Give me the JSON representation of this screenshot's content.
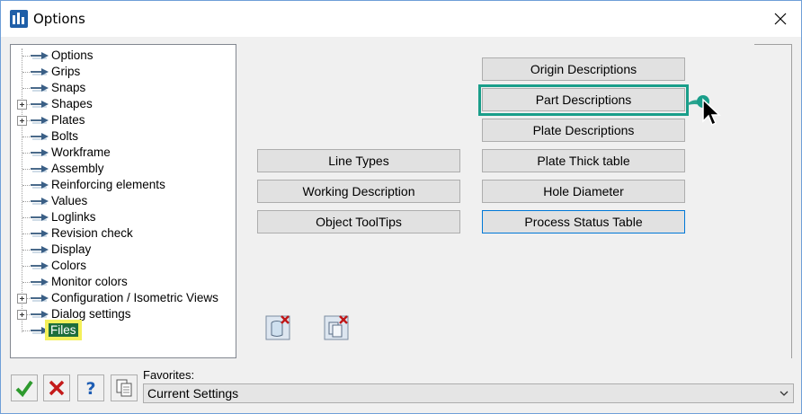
{
  "window": {
    "title": "Options"
  },
  "tree": {
    "items": [
      {
        "label": "Options",
        "expandable": false
      },
      {
        "label": "Grips",
        "expandable": false
      },
      {
        "label": "Snaps",
        "expandable": false
      },
      {
        "label": "Shapes",
        "expandable": true
      },
      {
        "label": "Plates",
        "expandable": true
      },
      {
        "label": "Bolts",
        "expandable": false
      },
      {
        "label": "Workframe",
        "expandable": false
      },
      {
        "label": "Assembly",
        "expandable": false
      },
      {
        "label": "Reinforcing elements",
        "expandable": false
      },
      {
        "label": "Values",
        "expandable": false
      },
      {
        "label": "Loglinks",
        "expandable": false
      },
      {
        "label": "Revision check",
        "expandable": false
      },
      {
        "label": "Display",
        "expandable": false
      },
      {
        "label": "Colors",
        "expandable": false
      },
      {
        "label": "Monitor colors",
        "expandable": false
      },
      {
        "label": "Configuration / Isometric Views",
        "expandable": true
      },
      {
        "label": "Dialog settings",
        "expandable": true
      },
      {
        "label": "Files",
        "expandable": false,
        "selected": true
      }
    ]
  },
  "buttons": {
    "origin_descriptions": "Origin Descriptions",
    "part_descriptions": "Part Descriptions",
    "plate_descriptions": "Plate Descriptions",
    "line_types": "Line Types",
    "plate_thick_table": "Plate Thick table",
    "working_description": "Working Description",
    "hole_diameter": "Hole Diameter",
    "object_tooltips": "Object ToolTips",
    "process_status_table": "Process Status Table"
  },
  "favorites": {
    "label": "Favorites:",
    "selected": "Current Settings"
  },
  "colors": {
    "highlight": "#1a9e8a",
    "selected_bg": "#1e6e3c",
    "selected_outline": "#f4f05a",
    "accent": "#0078d7"
  }
}
